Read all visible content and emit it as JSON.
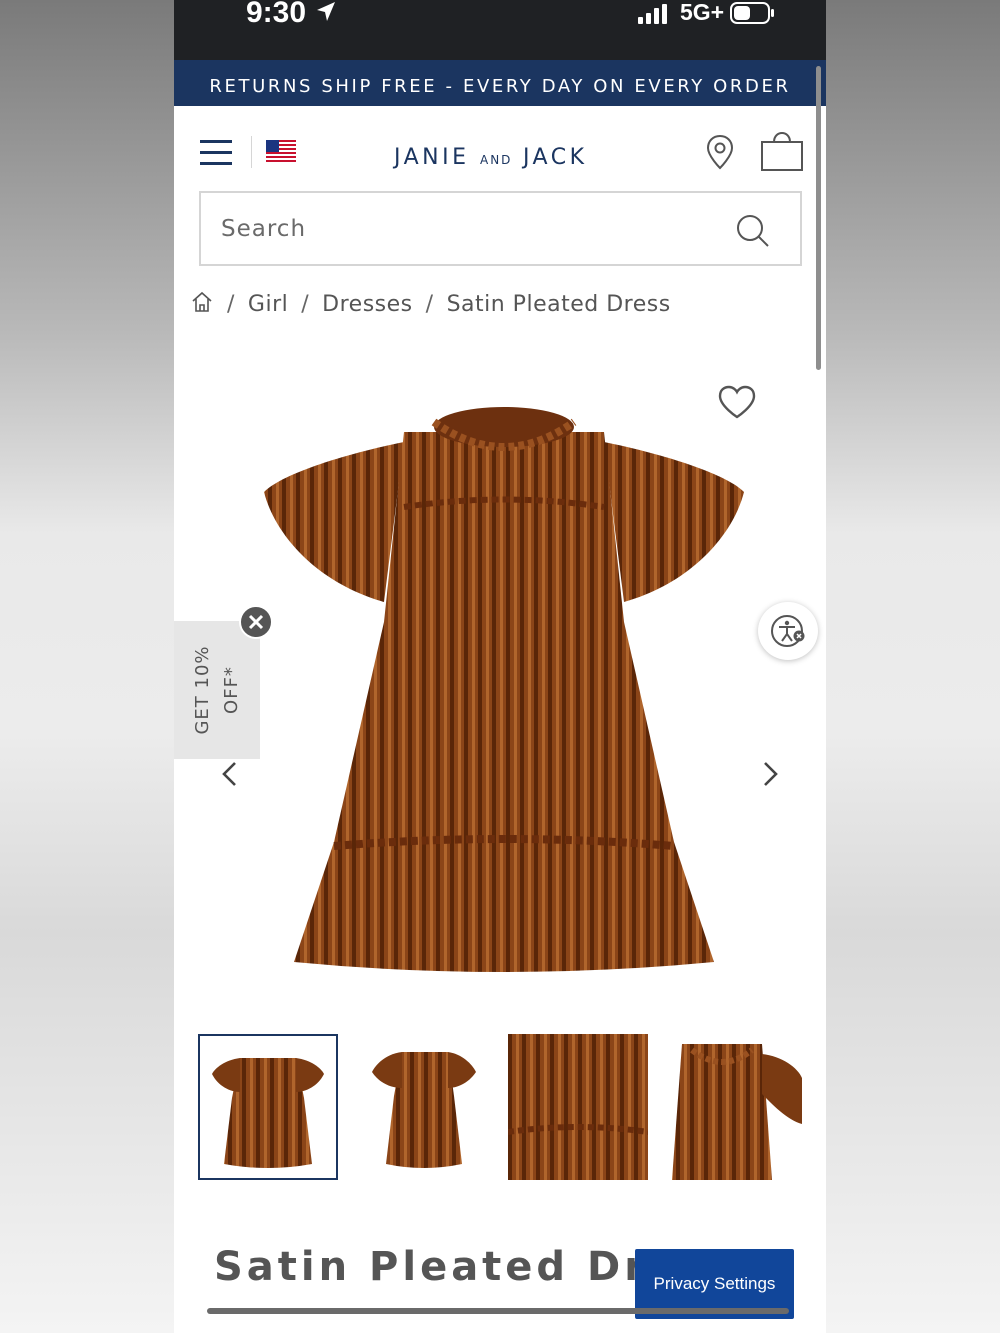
{
  "status_bar": {
    "time": "9:30",
    "network": "5G+"
  },
  "promo_banner": {
    "text": "RETURNS SHIP FREE - EVERY DAY ON EVERY ORDER"
  },
  "header": {
    "brand_left": "JANIE",
    "brand_mid": "AND",
    "brand_right": "JACK"
  },
  "search": {
    "placeholder": "Search",
    "value": ""
  },
  "breadcrumb": {
    "items": [
      "Girl",
      "Dresses",
      "Satin Pleated Dress"
    ]
  },
  "discount_tab": {
    "line1": "GET 10%",
    "line2": "OFF*"
  },
  "product": {
    "title": "Satin Pleated Dress",
    "color": "#8a4318",
    "thumbnails_count": 4,
    "selected_thumbnail": 1
  },
  "privacy_button": {
    "label": "Privacy Settings"
  },
  "colors": {
    "brand_navy": "#1b3560",
    "privacy_blue": "#11469a"
  }
}
